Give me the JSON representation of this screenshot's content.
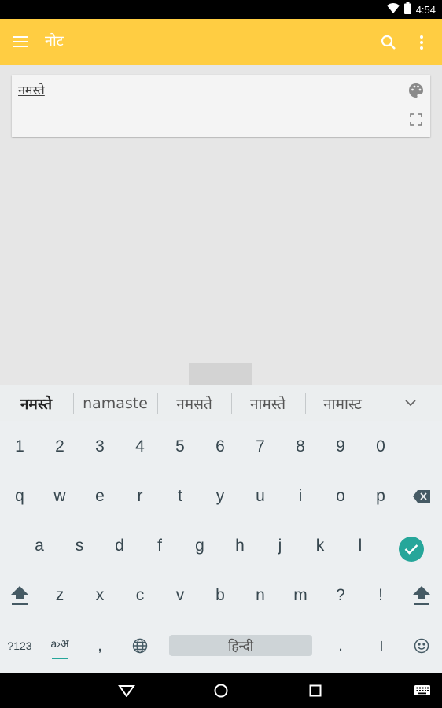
{
  "status_bar": {
    "time": "4:54"
  },
  "app_bar": {
    "title": "नोट"
  },
  "note": {
    "text": "नमस्ते"
  },
  "suggestions": [
    "नमस्ते",
    "namaste",
    "नमसते",
    "नामस्ते",
    "नामास्ट"
  ],
  "keyboard": {
    "row_numbers": [
      "1",
      "2",
      "3",
      "4",
      "5",
      "6",
      "7",
      "8",
      "9",
      "0"
    ],
    "row_1": [
      "q",
      "w",
      "e",
      "r",
      "t",
      "y",
      "u",
      "i",
      "o",
      "p"
    ],
    "row_2": [
      "a",
      "s",
      "d",
      "f",
      "g",
      "h",
      "j",
      "k",
      "l"
    ],
    "row_3": [
      "z",
      "x",
      "c",
      "v",
      "b",
      "n",
      "m",
      "?",
      "!"
    ],
    "symbols_label": "?123",
    "translit_label": "a›अ",
    "comma": ",",
    "space_label": "हिन्दी",
    "period": ".",
    "danda": "।"
  },
  "colors": {
    "app_bar": "#ffcd42",
    "enter_key": "#26a69a",
    "keyboard_bg": "#eceff1"
  }
}
